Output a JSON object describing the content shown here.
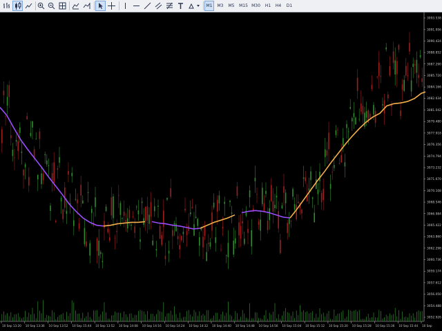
{
  "toolbar": {
    "timeframes": [
      "M1",
      "M3",
      "M5",
      "M15",
      "M30",
      "H1",
      "H4",
      "D1"
    ],
    "active_timeframe": "M1"
  },
  "colors": {
    "background": "#000000",
    "bull_candle": "#2e8b2e",
    "bear_candle": "#a01e1e",
    "ma_line_falling": "#9b4dff",
    "ma_line_rising": "#f5b04a",
    "axis": "#c8c8c8",
    "volume": "#2e8b2e"
  },
  "chart_data": {
    "type": "candlestick",
    "title": "",
    "series": [
      {
        "name": "",
        "kind": "moving_average"
      }
    ],
    "price_axis_labels": [
      "3093.538",
      "3091.956",
      "3090.424",
      "3088.852",
      "3087.290",
      "3085.720",
      "3084.166",
      "3082.634",
      "3081.042",
      "3079.480",
      "3077.918",
      "3076.356",
      "3074.794",
      "3073.232",
      "3071.670",
      "3070.108",
      "3068.546",
      "3066.984",
      "3065.422",
      "3063.860",
      "3062.298",
      "3060.736",
      "3059.174",
      "3057.612",
      "3056.050",
      "3054.488",
      "3052.926"
    ],
    "ylim": [
      3052.926,
      3093.538
    ],
    "time_axis_labels": [
      "10 Sep 13:20",
      "10 Sep 13:36",
      "10 Sep 13:52",
      "10 Sep 15:44",
      "10 Sep 13:52",
      "10 Sep 14:08",
      "10 Sep 14:16",
      "10 Sep 14:24",
      "10 Sep 14:32",
      "10 Sep 14:40",
      "10 Sep 14:48",
      "10 Sep 14:56",
      "10 Sep 15:04",
      "10 Sep 15:12",
      "10 Sep 15:20",
      "10 Sep 15:28",
      "10 Sep 15:36",
      "10 Sep 15:44",
      "10 Sep"
    ],
    "ma_points": [
      [
        0,
        3081.4
      ],
      [
        10,
        3080.3
      ],
      [
        20,
        3078.6
      ],
      [
        30,
        3077.0
      ],
      [
        40,
        3075.7
      ],
      [
        50,
        3074.5
      ],
      [
        60,
        3073.3
      ],
      [
        70,
        3072.0
      ],
      [
        80,
        3070.8
      ],
      [
        90,
        3069.6
      ],
      [
        100,
        3068.3
      ],
      [
        110,
        3067.3
      ],
      [
        120,
        3066.4
      ],
      [
        130,
        3065.8
      ],
      [
        140,
        3065.4
      ],
      [
        150,
        3065.3
      ],
      [
        160,
        3065.4
      ],
      [
        170,
        3065.6
      ],
      [
        180,
        3065.7
      ],
      [
        190,
        3065.8
      ],
      [
        200,
        3065.8
      ],
      [
        210,
        3065.9
      ],
      [
        220,
        3065.9
      ],
      [
        230,
        3065.7
      ],
      [
        240,
        3065.6
      ],
      [
        250,
        3065.4
      ],
      [
        260,
        3065.3
      ],
      [
        270,
        3065.1
      ],
      [
        280,
        3064.9
      ],
      [
        290,
        3065.0
      ],
      [
        300,
        3065.4
      ],
      [
        310,
        3065.8
      ],
      [
        320,
        3066.1
      ],
      [
        330,
        3066.4
      ],
      [
        340,
        3066.8
      ],
      [
        350,
        3067.1
      ],
      [
        360,
        3067.3
      ],
      [
        370,
        3067.4
      ],
      [
        380,
        3067.3
      ],
      [
        390,
        3067.1
      ],
      [
        400,
        3066.8
      ],
      [
        410,
        3066.5
      ],
      [
        420,
        3066.4
      ],
      [
        430,
        3067.6
      ],
      [
        440,
        3068.9
      ],
      [
        450,
        3070.2
      ],
      [
        460,
        3071.5
      ],
      [
        470,
        3072.7
      ],
      [
        480,
        3074.0
      ],
      [
        490,
        3075.2
      ],
      [
        500,
        3076.4
      ],
      [
        510,
        3077.5
      ],
      [
        520,
        3078.5
      ],
      [
        530,
        3079.4
      ],
      [
        540,
        3080.1
      ],
      [
        550,
        3080.6
      ],
      [
        560,
        3081.6
      ],
      [
        570,
        3081.9
      ],
      [
        580,
        3082.0
      ],
      [
        590,
        3082.2
      ],
      [
        600,
        3082.6
      ],
      [
        610,
        3083.3
      ],
      [
        616,
        3083.5
      ]
    ]
  }
}
